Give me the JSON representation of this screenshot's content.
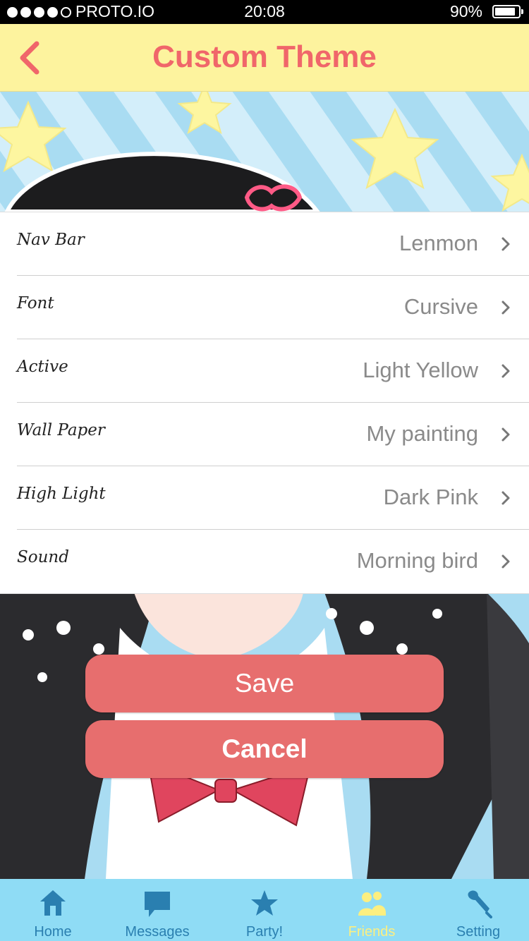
{
  "status_bar": {
    "carrier": "PROTO.IO",
    "time": "20:08",
    "battery": "90%",
    "signal_bars": 4
  },
  "nav_bar": {
    "title": "Custom Theme",
    "back_icon": "chevron-left-icon"
  },
  "settings": [
    {
      "label": "Nav Bar",
      "value": "Lenmon"
    },
    {
      "label": "Font",
      "value": "Cursive"
    },
    {
      "label": "Active",
      "value": "Light Yellow"
    },
    {
      "label": "Wall Paper",
      "value": "My painting"
    },
    {
      "label": "High Light",
      "value": "Dark Pink"
    },
    {
      "label": "Sound",
      "value": "Morning bird"
    }
  ],
  "buttons": {
    "save": "Save",
    "cancel": "Cancel"
  },
  "tab_bar": {
    "tabs": [
      {
        "label": "Home",
        "icon": "home-icon"
      },
      {
        "label": "Messages",
        "icon": "message-icon"
      },
      {
        "label": "Party!",
        "icon": "star-icon"
      },
      {
        "label": "Friends",
        "icon": "friends-icon",
        "active": true
      },
      {
        "label": "Setting",
        "icon": "wrench-icon"
      }
    ]
  },
  "colors": {
    "nav_bg": "#fdf39e",
    "title": "#f0666a",
    "button": "#e76e6e",
    "tab_bar": "#8fdcf5",
    "tab_label": "#2a7fb0",
    "tab_active": "#fcef80"
  }
}
